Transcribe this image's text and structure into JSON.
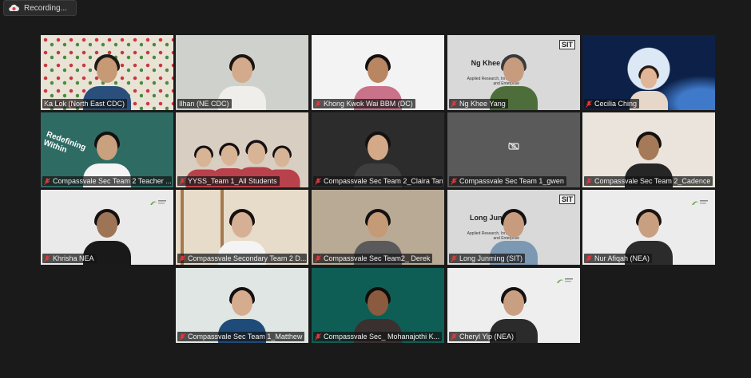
{
  "recording": {
    "label": "Recording..."
  },
  "tiles": [
    {
      "name": "Ka Lok (North East CDC)",
      "muted": false,
      "bg": "#e9e3d6",
      "skin": "#c59a74",
      "hair": "#1e1a16",
      "shirt": "#2a4f7c",
      "pattern": true
    },
    {
      "name": "Ilhan (NE CDC)",
      "muted": false,
      "bg": "#cfd1cc",
      "skin": "#d3aa8b",
      "hair": "#1b1411",
      "shirt": "#f0eeea",
      "active": true
    },
    {
      "name": "Khong Kwok Wai BBM (DC)",
      "muted": true,
      "bg": "#f3f3f3",
      "skin": "#b98662",
      "hair": "#141010",
      "shirt": "#c9728a"
    },
    {
      "name": "Ng Khee Yang",
      "muted": true,
      "bg": "#d9d9d9",
      "skin": "#c79c7e",
      "hair": "#3a3a3a",
      "shirt": "#4d6e3a",
      "sit": true,
      "sit_name": "Ng Khee Yang",
      "sit_sub": "Applied Research, Innovation and Enterprise"
    },
    {
      "name": "Cecilia Ching",
      "muted": true,
      "bg": "#0d2148",
      "skin": "#e1b597",
      "hair": "#2a1a12",
      "shirt": "#e6d7c9",
      "space": true
    },
    {
      "name": "Compassvale Sec Team 2 Teacher ...",
      "muted": true,
      "bg": "#2e6b63",
      "skin": "#c9a17e",
      "hair": "#141010",
      "shirt": "#f4f4f4",
      "sign": "Redefining Within"
    },
    {
      "name": "YYSS_Team 1_All Students",
      "muted": true,
      "bg": "#d8cec2",
      "skin": "#d8b497",
      "hair": "#151111",
      "shirt": "#b9414b",
      "group": true
    },
    {
      "name": "Compassvale Sec Team 2_Claira Tan",
      "muted": true,
      "bg": "#2c2c2c",
      "skin": "#d3a987",
      "hair": "#141010",
      "shirt": "#3e3e3e"
    },
    {
      "name": "Compassvale Sec Team 1_gwen",
      "muted": true,
      "bg": "#5a5a5a",
      "camoff": true
    },
    {
      "name": "Compassvale Sec Team 2_Cadence",
      "muted": true,
      "bg": "#eae4dc",
      "skin": "#a57a58",
      "hair": "#141010",
      "shirt": "#262626"
    },
    {
      "name": "Khrisha NEA",
      "muted": true,
      "bg": "#eaeaea",
      "skin": "#9e7457",
      "hair": "#141010",
      "shirt": "#191919",
      "nea": true
    },
    {
      "name": "Compassvale Secondary Team 2 D...",
      "muted": true,
      "bg": "#e7dbc9",
      "skin": "#d6b094",
      "hair": "#151111",
      "shirt": "#f4f4f4",
      "bunk": true
    },
    {
      "name": "Compassvale Sec Team2_ Derek",
      "muted": true,
      "bg": "#b9aa96",
      "skin": "#c49a77",
      "hair": "#141010",
      "shirt": "#5a5a5a"
    },
    {
      "name": "Long Junming (SIT)",
      "muted": true,
      "bg": "#d9d9d9",
      "skin": "#c79c7e",
      "hair": "#141010",
      "shirt": "#7d98b3",
      "sit": true,
      "sit_name": "Long Junming",
      "sit_sub": "Applied Research, Innovation and Enterprise"
    },
    {
      "name": "Nur Afiqah (NEA)",
      "muted": true,
      "bg": "#ececec",
      "skin": "#c99f82",
      "hair": "#1c1410",
      "shirt": "#2b2b2b",
      "nea": true
    },
    {
      "name": "Compassvale Sec Team 1_Matthew",
      "muted": true,
      "bg": "#dfe6e3",
      "skin": "#d5ad8e",
      "hair": "#141010",
      "shirt": "#1e4b7a"
    },
    {
      "name": "Compassvale Sec_ Mohanajothi K...",
      "muted": true,
      "bg": "#0f5e55",
      "skin": "#8a5b3e",
      "hair": "#120d0b",
      "shirt": "#3a3030"
    },
    {
      "name": "Cheryl Yip (NEA)",
      "muted": true,
      "bg": "#eeeeee",
      "skin": "#c99f82",
      "hair": "#141010",
      "shirt": "#2b2b2b",
      "nea": true
    }
  ],
  "colors": {
    "active_border": "#c7e55a",
    "mute_red": "#e0383e",
    "background": "#1a1a1a"
  }
}
